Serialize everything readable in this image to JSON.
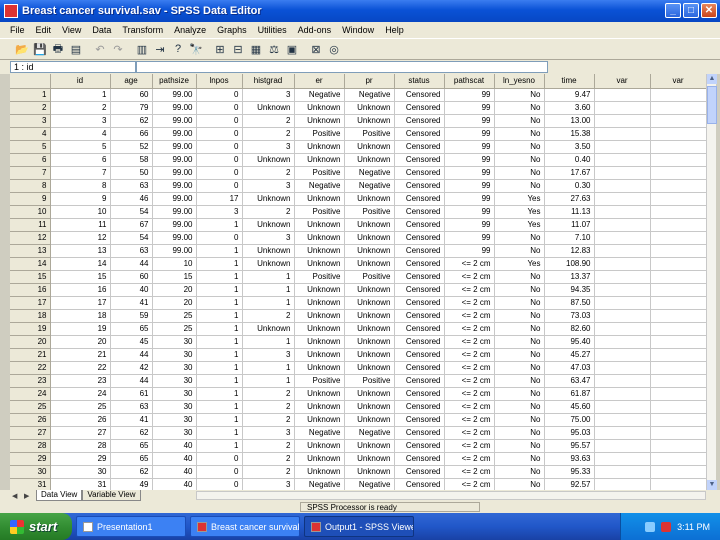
{
  "window": {
    "title": "Breast cancer survival.sav - SPSS Data Editor"
  },
  "menu": [
    "File",
    "Edit",
    "View",
    "Data",
    "Transform",
    "Analyze",
    "Graphs",
    "Utilities",
    "Add-ons",
    "Window",
    "Help"
  ],
  "cell": {
    "ref": "1 : id",
    "value": ""
  },
  "columns": [
    "id",
    "age",
    "pathsize",
    "lnpos",
    "histgrad",
    "er",
    "pr",
    "status",
    "pathscat",
    "ln_yesno",
    "time",
    "var",
    "var"
  ],
  "rows": [
    [
      "1",
      "1",
      "60",
      "99.00",
      "0",
      "3",
      "Negative",
      "Negative",
      "Censored",
      "99",
      "No",
      "9.47",
      "",
      ""
    ],
    [
      "2",
      "2",
      "79",
      "99.00",
      "0",
      "Unknown",
      "Unknown",
      "Unknown",
      "Censored",
      "99",
      "No",
      "3.60",
      "",
      ""
    ],
    [
      "3",
      "3",
      "62",
      "99.00",
      "0",
      "2",
      "Unknown",
      "Unknown",
      "Censored",
      "99",
      "No",
      "13.00",
      "",
      ""
    ],
    [
      "4",
      "4",
      "66",
      "99.00",
      "0",
      "2",
      "Positive",
      "Positive",
      "Censored",
      "99",
      "No",
      "15.38",
      "",
      ""
    ],
    [
      "5",
      "5",
      "52",
      "99.00",
      "0",
      "3",
      "Unknown",
      "Unknown",
      "Censored",
      "99",
      "No",
      "3.50",
      "",
      ""
    ],
    [
      "6",
      "6",
      "58",
      "99.00",
      "0",
      "Unknown",
      "Unknown",
      "Unknown",
      "Censored",
      "99",
      "No",
      "0.40",
      "",
      ""
    ],
    [
      "7",
      "7",
      "50",
      "99.00",
      "0",
      "2",
      "Positive",
      "Negative",
      "Censored",
      "99",
      "No",
      "17.67",
      "",
      ""
    ],
    [
      "8",
      "8",
      "63",
      "99.00",
      "0",
      "3",
      "Negative",
      "Negative",
      "Censored",
      "99",
      "No",
      "0.30",
      "",
      ""
    ],
    [
      "9",
      "9",
      "46",
      "99.00",
      "17",
      "Unknown",
      "Unknown",
      "Unknown",
      "Censored",
      "99",
      "Yes",
      "27.63",
      "",
      ""
    ],
    [
      "10",
      "10",
      "54",
      "99.00",
      "3",
      "2",
      "Positive",
      "Positive",
      "Censored",
      "99",
      "Yes",
      "11.13",
      "",
      ""
    ],
    [
      "11",
      "11",
      "67",
      "99.00",
      "1",
      "Unknown",
      "Unknown",
      "Unknown",
      "Censored",
      "99",
      "Yes",
      "11.07",
      "",
      ""
    ],
    [
      "12",
      "12",
      "54",
      "99.00",
      "0",
      "3",
      "Unknown",
      "Unknown",
      "Censored",
      "99",
      "No",
      "7.10",
      "",
      ""
    ],
    [
      "13",
      "13",
      "63",
      "99.00",
      "1",
      "Unknown",
      "Unknown",
      "Unknown",
      "Censored",
      "99",
      "No",
      "12.83",
      "",
      ""
    ],
    [
      "14",
      "14",
      "44",
      "10",
      "1",
      "Unknown",
      "Unknown",
      "Unknown",
      "Censored",
      "<= 2 cm",
      "Yes",
      "108.90",
      "",
      ""
    ],
    [
      "15",
      "15",
      "60",
      "15",
      "1",
      "1",
      "Positive",
      "Positive",
      "Censored",
      "<= 2 cm",
      "No",
      "13.37",
      "",
      ""
    ],
    [
      "16",
      "16",
      "40",
      "20",
      "1",
      "1",
      "Unknown",
      "Unknown",
      "Censored",
      "<= 2 cm",
      "No",
      "94.35",
      "",
      ""
    ],
    [
      "17",
      "17",
      "41",
      "20",
      "1",
      "1",
      "Unknown",
      "Unknown",
      "Censored",
      "<= 2 cm",
      "No",
      "87.50",
      "",
      ""
    ],
    [
      "18",
      "18",
      "59",
      "25",
      "1",
      "2",
      "Unknown",
      "Unknown",
      "Censored",
      "<= 2 cm",
      "No",
      "73.03",
      "",
      ""
    ],
    [
      "19",
      "19",
      "65",
      "25",
      "1",
      "Unknown",
      "Unknown",
      "Unknown",
      "Censored",
      "<= 2 cm",
      "No",
      "82.60",
      "",
      ""
    ],
    [
      "20",
      "20",
      "45",
      "30",
      "1",
      "1",
      "Unknown",
      "Unknown",
      "Censored",
      "<= 2 cm",
      "No",
      "95.40",
      "",
      ""
    ],
    [
      "21",
      "21",
      "44",
      "30",
      "1",
      "3",
      "Unknown",
      "Unknown",
      "Censored",
      "<= 2 cm",
      "No",
      "45.27",
      "",
      ""
    ],
    [
      "22",
      "22",
      "42",
      "30",
      "1",
      "1",
      "Unknown",
      "Unknown",
      "Censored",
      "<= 2 cm",
      "No",
      "47.03",
      "",
      ""
    ],
    [
      "23",
      "23",
      "44",
      "30",
      "1",
      "1",
      "Positive",
      "Positive",
      "Censored",
      "<= 2 cm",
      "No",
      "63.47",
      "",
      ""
    ],
    [
      "24",
      "24",
      "61",
      "30",
      "1",
      "2",
      "Unknown",
      "Unknown",
      "Censored",
      "<= 2 cm",
      "No",
      "61.87",
      "",
      ""
    ],
    [
      "25",
      "25",
      "63",
      "30",
      "1",
      "2",
      "Unknown",
      "Unknown",
      "Censored",
      "<= 2 cm",
      "No",
      "45.60",
      "",
      ""
    ],
    [
      "26",
      "26",
      "41",
      "30",
      "1",
      "2",
      "Unknown",
      "Unknown",
      "Censored",
      "<= 2 cm",
      "No",
      "75.00",
      "",
      ""
    ],
    [
      "27",
      "27",
      "62",
      "30",
      "1",
      "3",
      "Negative",
      "Negative",
      "Censored",
      "<= 2 cm",
      "No",
      "95.03",
      "",
      ""
    ],
    [
      "28",
      "28",
      "65",
      "40",
      "1",
      "2",
      "Unknown",
      "Unknown",
      "Censored",
      "<= 2 cm",
      "No",
      "95.57",
      "",
      ""
    ],
    [
      "29",
      "29",
      "65",
      "40",
      "0",
      "2",
      "Unknown",
      "Unknown",
      "Censored",
      "<= 2 cm",
      "No",
      "93.63",
      "",
      ""
    ],
    [
      "30",
      "30",
      "62",
      "40",
      "0",
      "2",
      "Unknown",
      "Unknown",
      "Censored",
      "<= 2 cm",
      "No",
      "95.33",
      "",
      ""
    ],
    [
      "31",
      "31",
      "49",
      "40",
      "0",
      "3",
      "Negative",
      "Negative",
      "Censored",
      "<= 2 cm",
      "No",
      "92.57",
      "",
      ""
    ]
  ],
  "tabs": {
    "data_view": "Data View",
    "variable_view": "Variable View"
  },
  "status": {
    "message": "SPSS Processor is ready"
  },
  "taskbar": {
    "start": "start",
    "tasks": [
      "Presentation1",
      "Breast cancer survival...",
      "Output1 - SPSS Viewer"
    ],
    "clock": "3:11 PM"
  },
  "colors": {
    "titlebar": "#0a52d6",
    "taskbar": "#2157c8",
    "start": "#2f8a2f"
  }
}
